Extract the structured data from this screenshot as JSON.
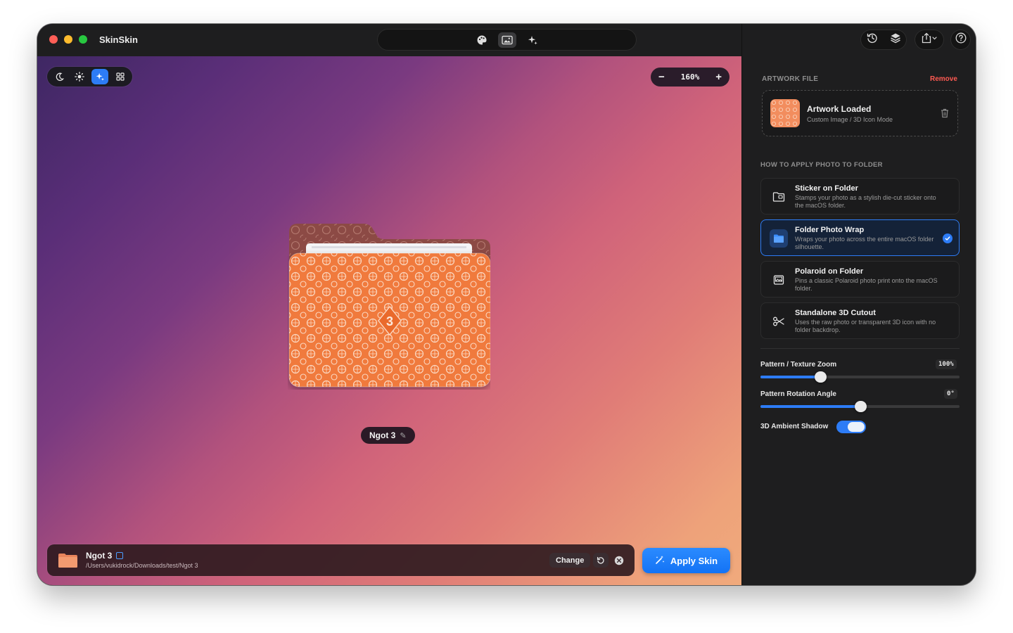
{
  "app": {
    "title": "SkinSkin"
  },
  "toolbar": {
    "top_segments": [
      "palette-icon",
      "image-icon",
      "sparkles-icon"
    ],
    "right_buttons": [
      "history-icon",
      "layers-icon",
      "share-icon",
      "help-icon"
    ]
  },
  "canvas": {
    "mode_buttons": [
      "moon-icon",
      "sun-icon",
      "sparkle-icon",
      "grid-icon"
    ],
    "active_mode": "sparkle-icon",
    "zoom": {
      "minus": "−",
      "value": "160%",
      "plus": "+"
    },
    "folder_name": "Ngot 3",
    "folder_badge": "3"
  },
  "bottom_bar": {
    "name": "Ngot 3",
    "path": "/Users/vukidrock/Downloads/test/Ngot 3",
    "change_label": "Change"
  },
  "apply_label": "Apply Skin",
  "panel": {
    "artwork_label": "ARTWORK FILE",
    "remove_label": "Remove",
    "artwork_title": "Artwork Loaded",
    "artwork_sub": "Custom Image / 3D Icon Mode",
    "apply_section_label": "HOW TO APPLY PHOTO TO FOLDER",
    "options": [
      {
        "title": "Sticker on Folder",
        "desc": "Stamps your photo as a stylish die-cut sticker onto the macOS folder.",
        "icon": "sticker-icon",
        "selected": false
      },
      {
        "title": "Folder Photo Wrap",
        "desc": "Wraps your photo across the entire macOS folder silhouette.",
        "icon": "folder-icon",
        "selected": true
      },
      {
        "title": "Polaroid on Folder",
        "desc": "Pins a classic Polaroid photo print onto the macOS folder.",
        "icon": "polaroid-icon",
        "selected": false
      },
      {
        "title": "Standalone 3D Cutout",
        "desc": "Uses the raw photo or transparent 3D icon with no folder backdrop.",
        "icon": "scissors-icon",
        "selected": false
      }
    ],
    "zoom_label": "Pattern / Texture Zoom",
    "zoom_value": "100%",
    "zoom_fraction": 0.3,
    "rotation_label": "Pattern Rotation Angle",
    "rotation_value": "0°",
    "rotation_fraction": 0.5,
    "shadow_label": "3D Ambient Shadow",
    "shadow_on": true
  },
  "colors": {
    "accent": "#2d7cf6",
    "remove": "#ff5a52",
    "folder_orange": "#f07a3c"
  }
}
